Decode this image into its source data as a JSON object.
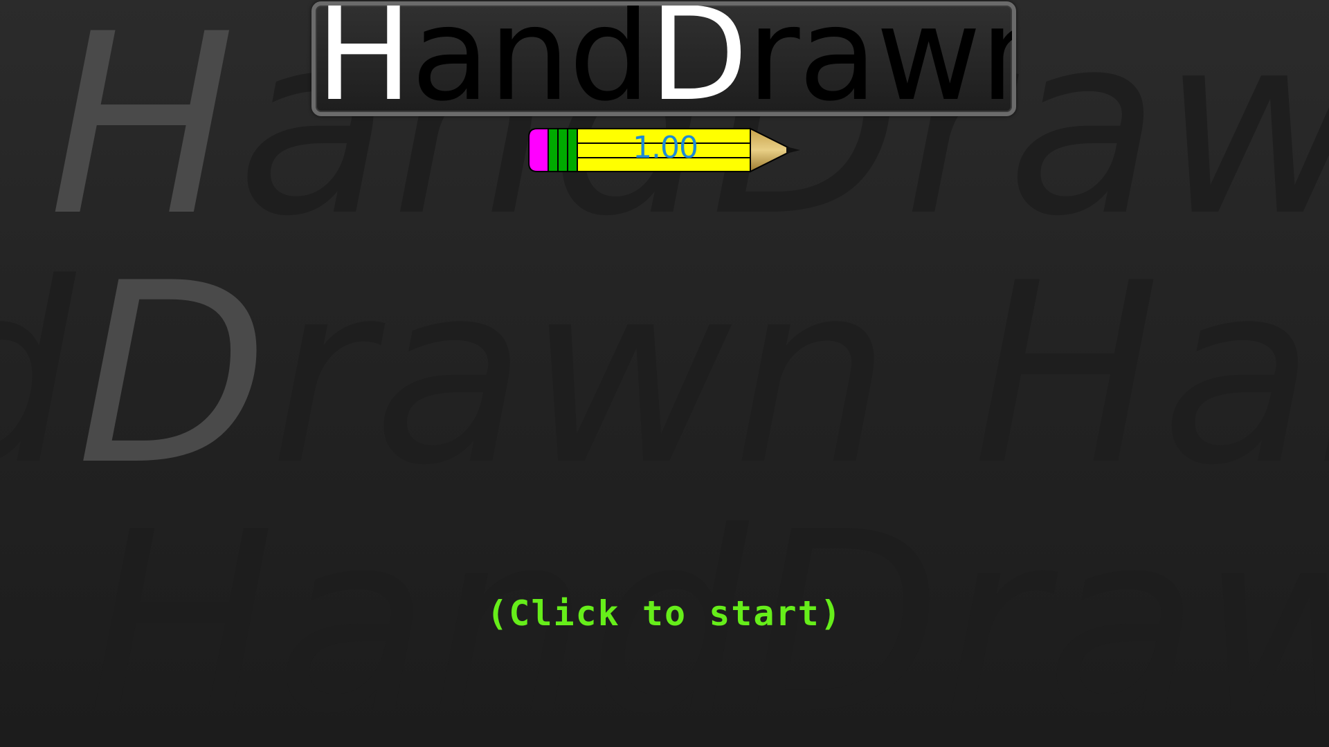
{
  "background": {
    "watermark_rows": [
      "HandDrawn",
      "dDrawn HandD",
      "n HandDrawn"
    ]
  },
  "title": {
    "text": "HandDrawn",
    "parts": [
      "H",
      "and",
      "D",
      "rawn"
    ]
  },
  "version": {
    "label": "1.00"
  },
  "start_prompt": "(Click to start)",
  "colors": {
    "title_highlight": "#ffffff",
    "title_body": "#000000",
    "version_text": "#1d8ad6",
    "prompt_text": "#66ee1a",
    "pencil_body": "#ffff00",
    "pencil_eraser": "#ff00ff",
    "pencil_band": "#00aa00"
  },
  "icons": {
    "pencil": "pencil-icon"
  }
}
